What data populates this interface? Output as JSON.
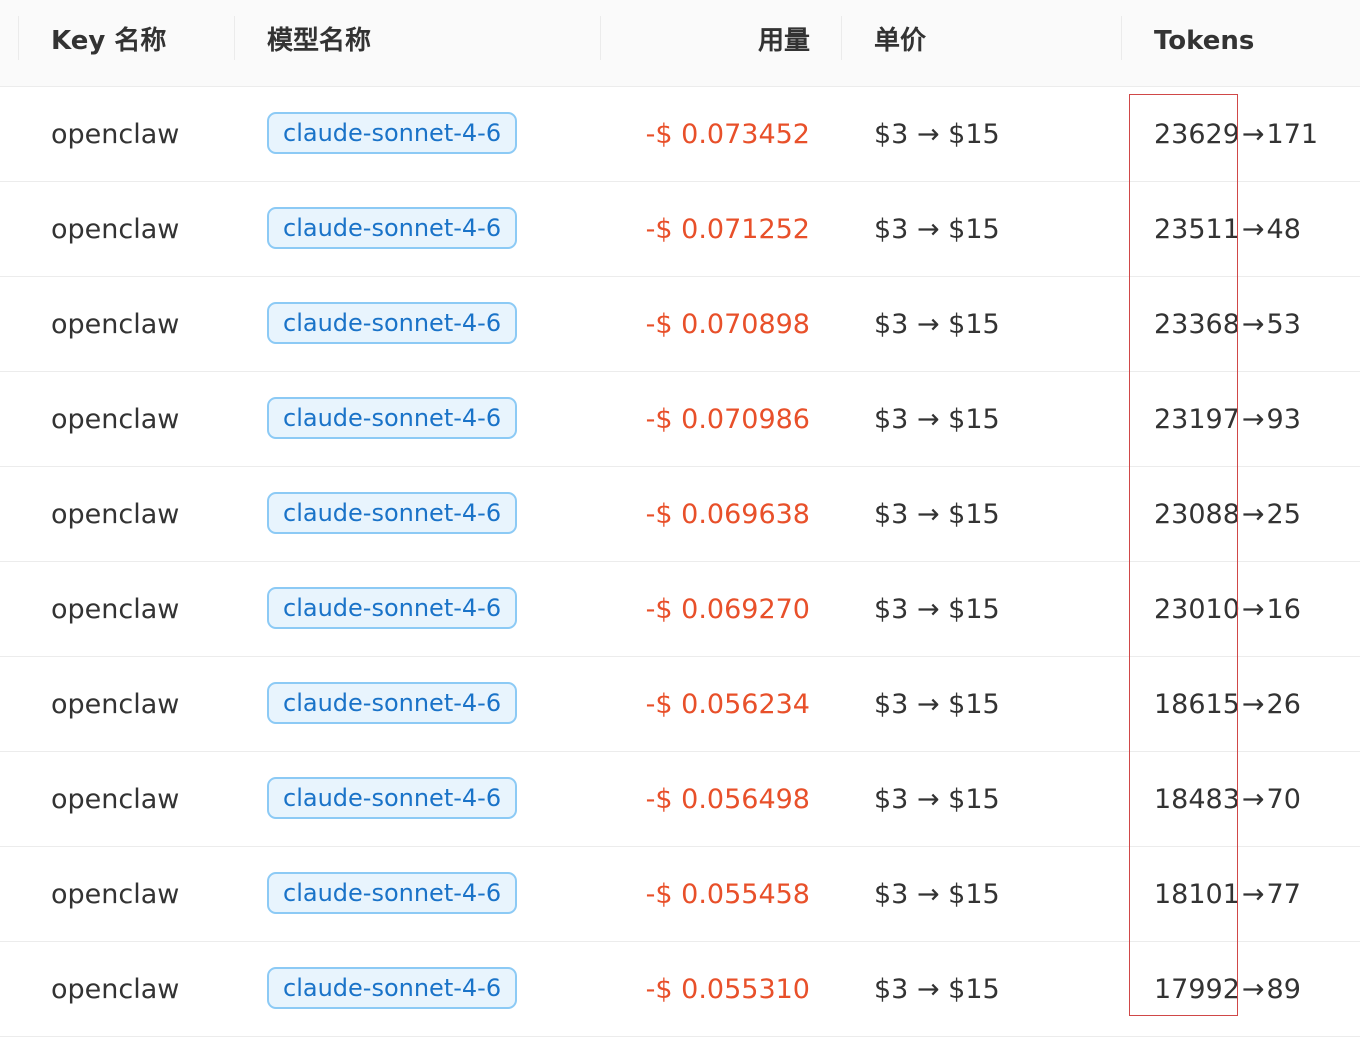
{
  "table": {
    "headers": {
      "key": "Key 名称",
      "model": "模型名称",
      "usage": "用量",
      "price": "单价",
      "tokens": "Tokens"
    },
    "rows": [
      {
        "key": "openclaw",
        "model": "claude-sonnet-4-6",
        "usage": "-$ 0.073452",
        "price": "$3 → $15",
        "tokens_in": "23629",
        "tokens_arrow": "→",
        "tokens_out": "171"
      },
      {
        "key": "openclaw",
        "model": "claude-sonnet-4-6",
        "usage": "-$ 0.071252",
        "price": "$3 → $15",
        "tokens_in": "23511",
        "tokens_arrow": "→",
        "tokens_out": "48"
      },
      {
        "key": "openclaw",
        "model": "claude-sonnet-4-6",
        "usage": "-$ 0.070898",
        "price": "$3 → $15",
        "tokens_in": "23368",
        "tokens_arrow": "→",
        "tokens_out": "53"
      },
      {
        "key": "openclaw",
        "model": "claude-sonnet-4-6",
        "usage": "-$ 0.070986",
        "price": "$3 → $15",
        "tokens_in": "23197",
        "tokens_arrow": "→",
        "tokens_out": "93"
      },
      {
        "key": "openclaw",
        "model": "claude-sonnet-4-6",
        "usage": "-$ 0.069638",
        "price": "$3 → $15",
        "tokens_in": "23088",
        "tokens_arrow": "→",
        "tokens_out": "25"
      },
      {
        "key": "openclaw",
        "model": "claude-sonnet-4-6",
        "usage": "-$ 0.069270",
        "price": "$3 → $15",
        "tokens_in": "23010",
        "tokens_arrow": "→",
        "tokens_out": "16"
      },
      {
        "key": "openclaw",
        "model": "claude-sonnet-4-6",
        "usage": "-$ 0.056234",
        "price": "$3 → $15",
        "tokens_in": "18615",
        "tokens_arrow": "→",
        "tokens_out": "26"
      },
      {
        "key": "openclaw",
        "model": "claude-sonnet-4-6",
        "usage": "-$ 0.056498",
        "price": "$3 → $15",
        "tokens_in": "18483",
        "tokens_arrow": "→",
        "tokens_out": "70"
      },
      {
        "key": "openclaw",
        "model": "claude-sonnet-4-6",
        "usage": "-$ 0.055458",
        "price": "$3 → $15",
        "tokens_in": "18101",
        "tokens_arrow": "→",
        "tokens_out": "77"
      },
      {
        "key": "openclaw",
        "model": "claude-sonnet-4-6",
        "usage": "-$ 0.055310",
        "price": "$3 → $15",
        "tokens_in": "17992",
        "tokens_arrow": "→",
        "tokens_out": "89"
      }
    ]
  },
  "colors": {
    "usage_negative": "#e8502a",
    "tag_text": "#1a73c8",
    "tag_bg": "#e8f4fd",
    "tag_border": "#8ccaf5",
    "highlight_box": "#d04848"
  }
}
